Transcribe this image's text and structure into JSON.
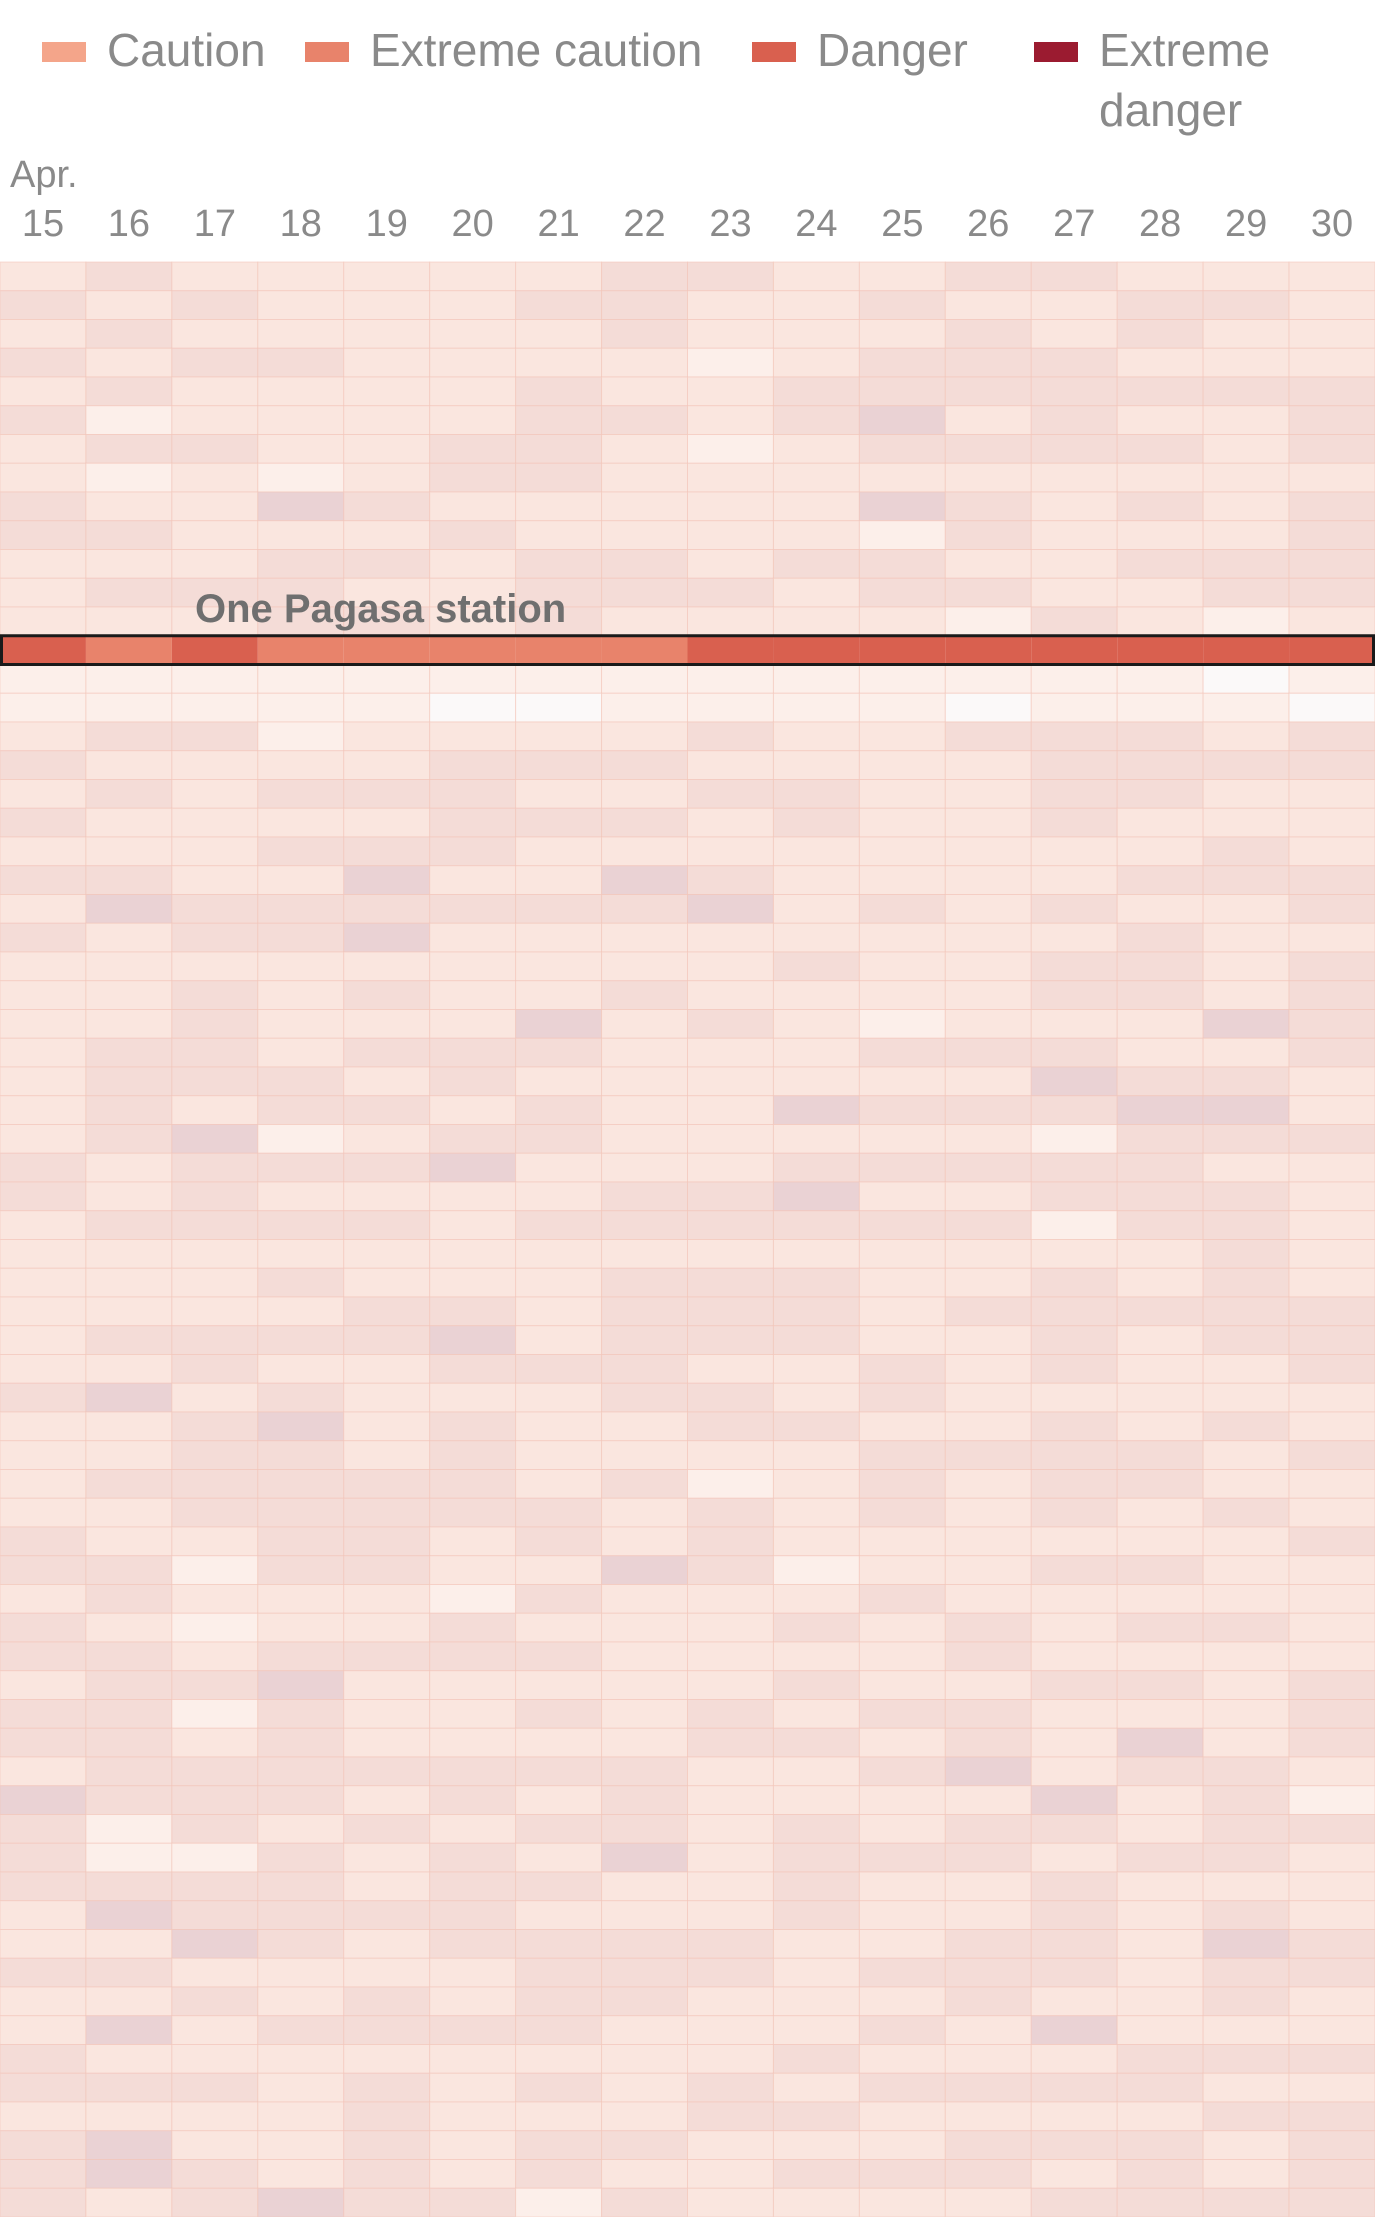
{
  "legend": {
    "items": [
      {
        "label": "Caution",
        "color": "#f4a58a"
      },
      {
        "label": "Extreme caution",
        "color": "#e8836b"
      },
      {
        "label": "Danger",
        "color": "#d9604f"
      },
      {
        "label": "Extreme danger",
        "color": "#9b1b30"
      }
    ]
  },
  "chart_data": {
    "type": "heatmap",
    "month_label": "Apr.",
    "x_categories": [
      "15",
      "16",
      "17",
      "18",
      "19",
      "20",
      "21",
      "22",
      "23",
      "24",
      "25",
      "26",
      "27",
      "28",
      "29",
      "30"
    ],
    "row_count": 68,
    "highlight": {
      "label": "One Pagasa station",
      "row_index": 13,
      "levels": [
        "Danger",
        "Extreme caution",
        "Danger",
        "Extreme caution",
        "Extreme caution",
        "Extreme caution",
        "Extreme caution",
        "Extreme caution",
        "Danger",
        "Danger",
        "Danger",
        "Danger",
        "Danger",
        "Danger",
        "Danger",
        "Danger"
      ]
    },
    "colors": {
      "cell_light": "#fae6df",
      "cell_medium": "#f4dcd7",
      "cell_pale": "#fcefea",
      "cell_blank": "#fbf9f9",
      "cell_mauve": "#ead2d4",
      "grid_line": "#f3c2b6"
    }
  }
}
